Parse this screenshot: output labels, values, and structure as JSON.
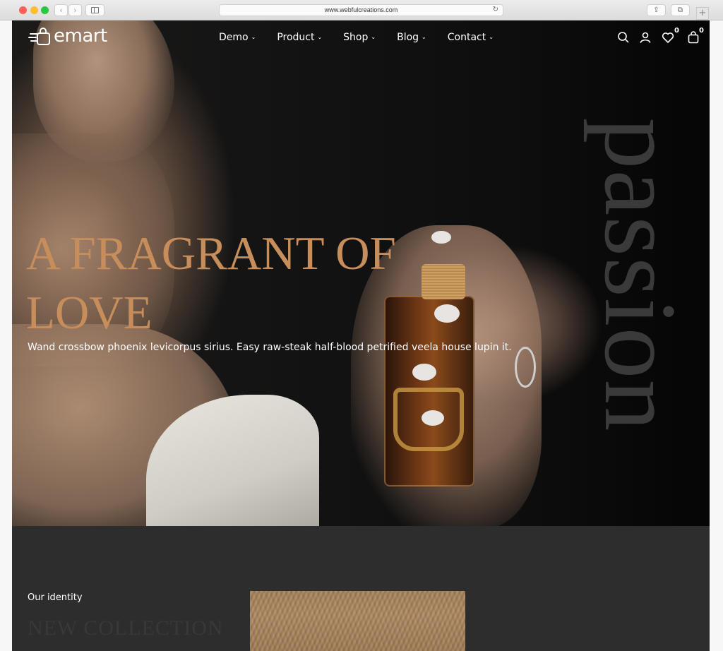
{
  "browser": {
    "url": "www.webfulcreations.com",
    "back_icon": "‹",
    "forward_icon": "›",
    "reload_icon": "↻",
    "share_icon": "⇪",
    "tabs_icon": "⧉",
    "newtab_icon": "+"
  },
  "header": {
    "logo_text": "emart",
    "nav": [
      {
        "label": "Demo",
        "chevron": "⌄"
      },
      {
        "label": "Product",
        "chevron": "⌄"
      },
      {
        "label": "Shop",
        "chevron": "⌄"
      },
      {
        "label": "Blog",
        "chevron": "⌄"
      },
      {
        "label": "Contact",
        "chevron": "⌄"
      }
    ],
    "wishlist_count": "0",
    "cart_count": "0"
  },
  "hero": {
    "title": "A FRAGRANT OF LOVE",
    "subtitle": "Wand crossbow phoenix levicorpus sirius. Easy raw-steak half-blood petrified veela house lupin it.",
    "side_word": "passion"
  },
  "identity": {
    "eyebrow": "Our identity",
    "heading": "NEW COLLECTION"
  },
  "colors": {
    "accent": "#c78e5c",
    "hero_bg": "#0d0d0d",
    "section_bg": "#2d2d2d"
  }
}
